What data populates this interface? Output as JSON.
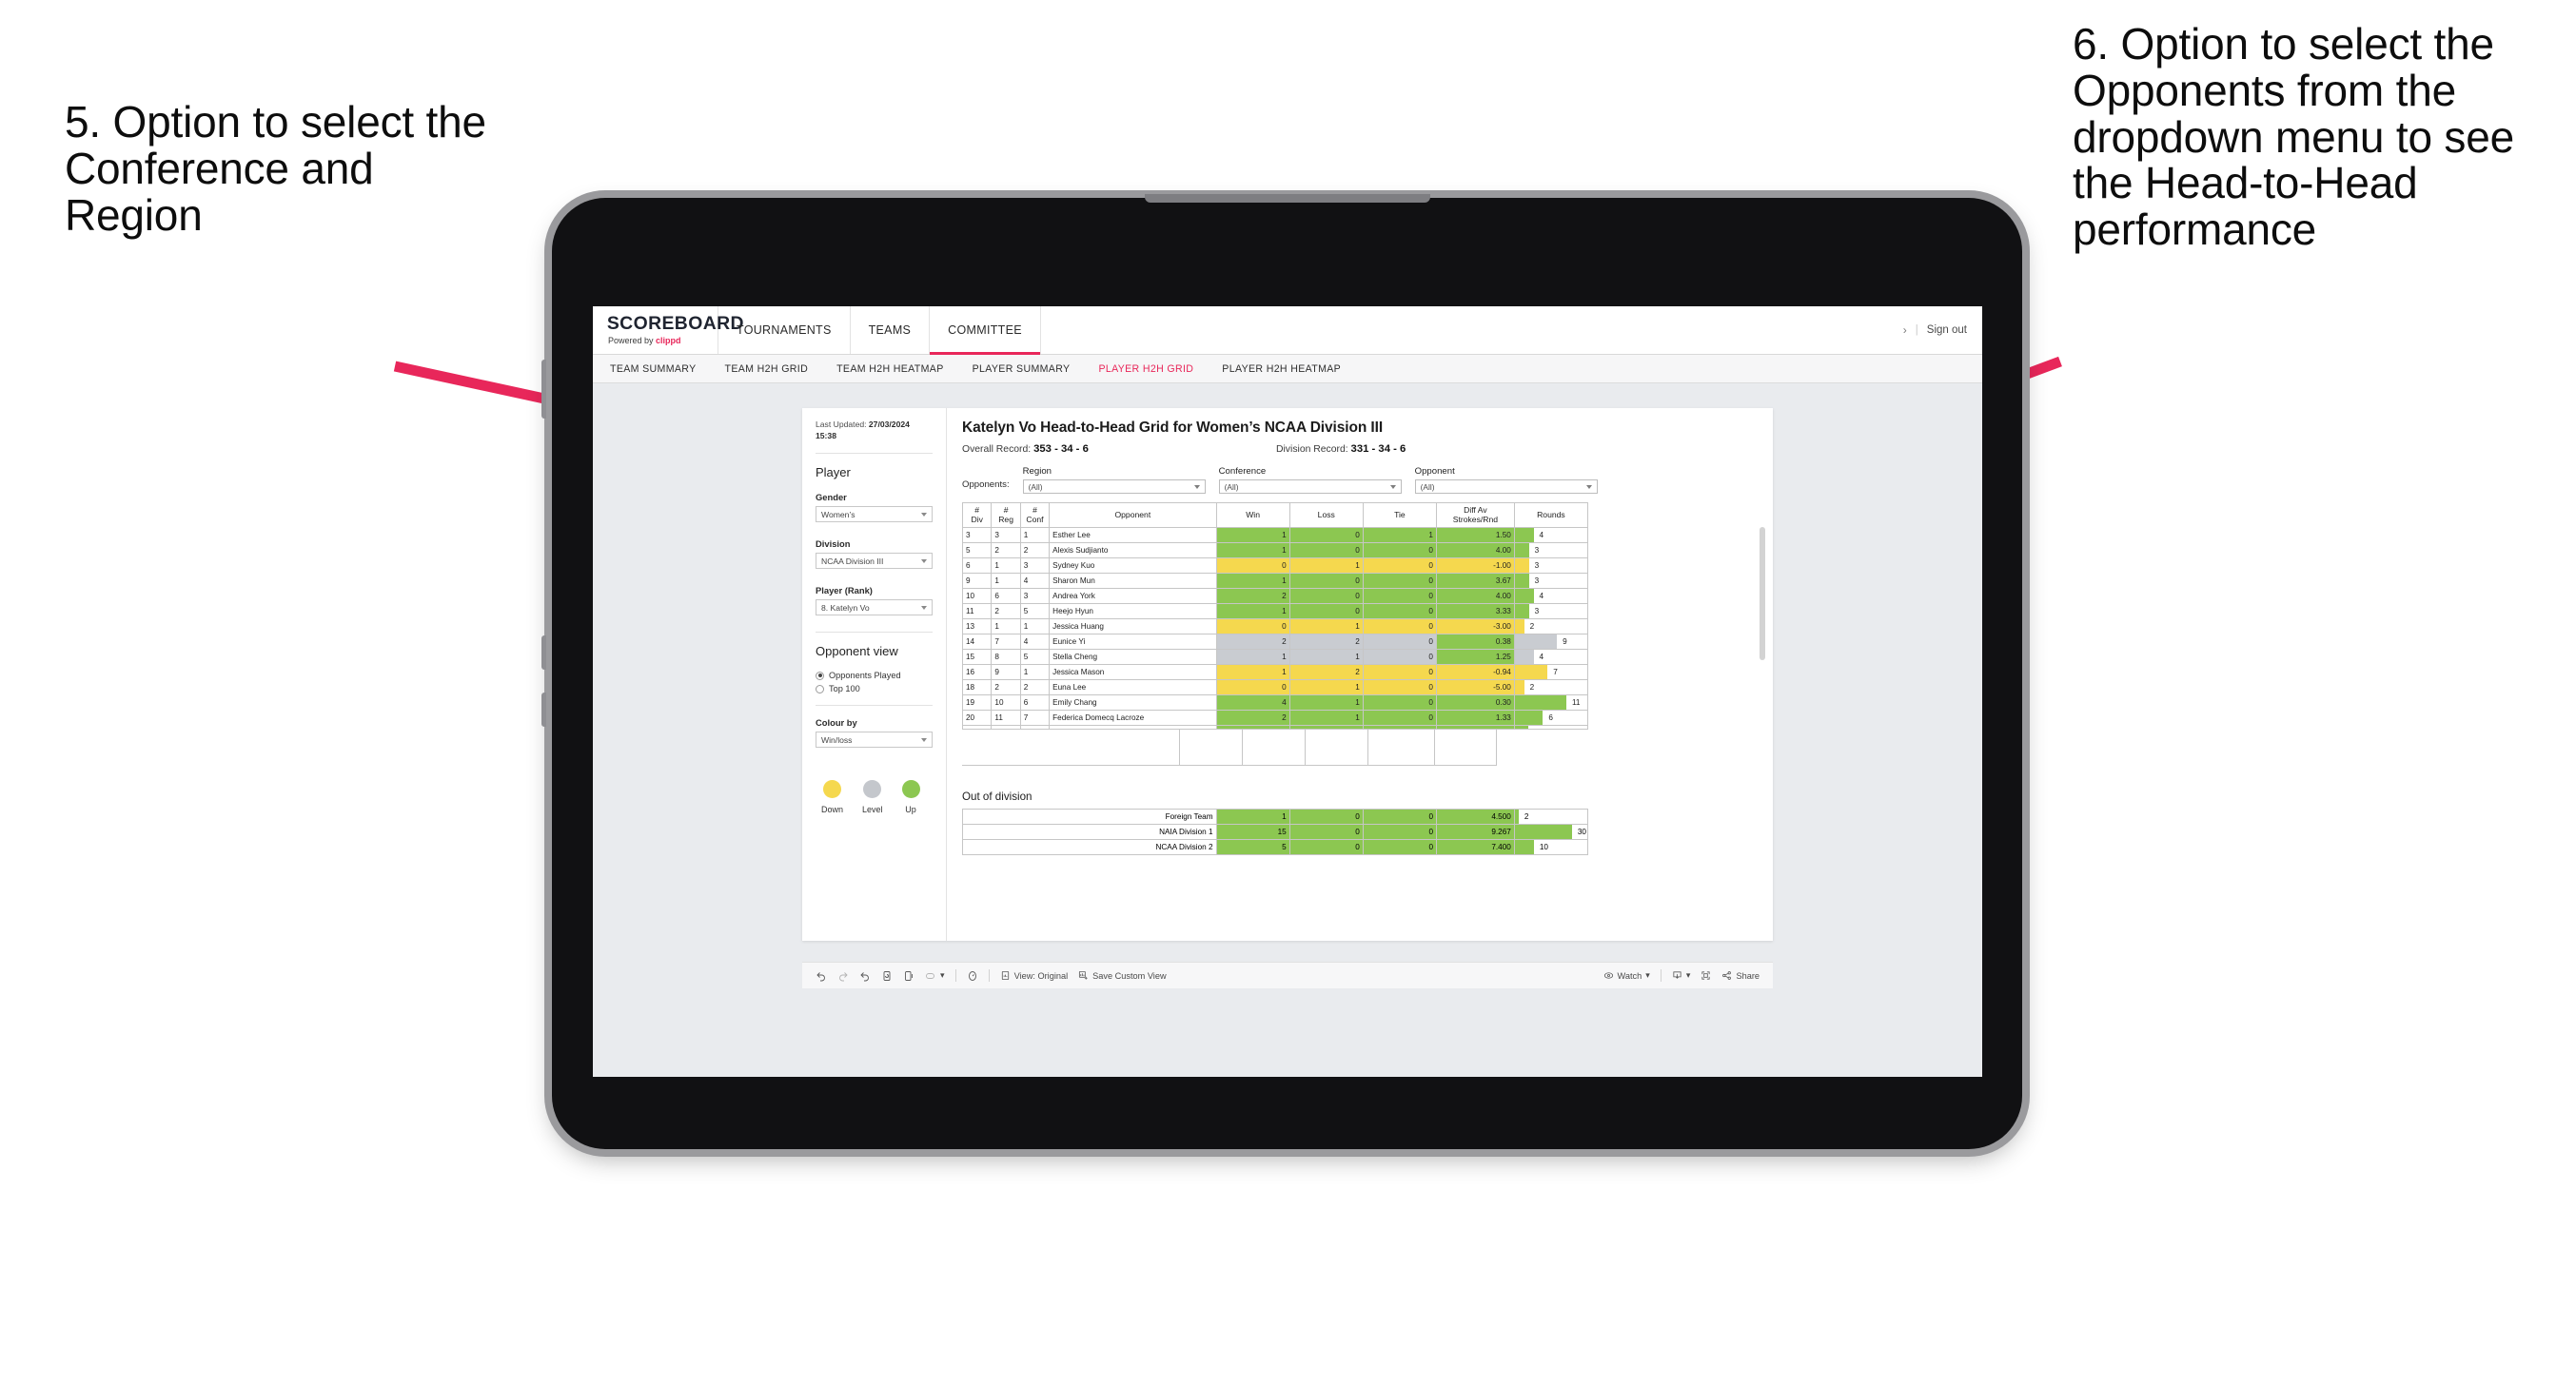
{
  "annotations": {
    "left": "5. Option to select the Conference and Region",
    "right": "6. Option to select the Opponents from the dropdown menu to see the Head-to-Head performance",
    "arrow_color": "#e8275a"
  },
  "app": {
    "logo": {
      "main": "SCOREBOARD",
      "sub_prefix": "Powered by ",
      "brand": "clippd"
    },
    "top_nav": [
      {
        "label": "TOURNAMENTS",
        "active": false
      },
      {
        "label": "TEAMS",
        "active": false
      },
      {
        "label": "COMMITTEE",
        "active": true
      }
    ],
    "header_right": {
      "chevron": "›",
      "separator": "|",
      "sign_out": "Sign out"
    },
    "sub_nav": [
      {
        "label": "TEAM SUMMARY",
        "active": false
      },
      {
        "label": "TEAM H2H GRID",
        "active": false
      },
      {
        "label": "TEAM H2H HEATMAP",
        "active": false
      },
      {
        "label": "PLAYER SUMMARY",
        "active": false
      },
      {
        "label": "PLAYER H2H GRID",
        "active": true
      },
      {
        "label": "PLAYER H2H HEATMAP",
        "active": false
      }
    ],
    "accent_color": "#e8275a"
  },
  "sidebar": {
    "last_updated_label": "Last Updated:",
    "last_updated_value": "27/03/2024",
    "last_updated_time": "15:38",
    "player_group_title": "Player",
    "gender": {
      "label": "Gender",
      "value": "Women’s"
    },
    "division": {
      "label": "Division",
      "value": "NCAA Division III"
    },
    "player_rank": {
      "label": "Player (Rank)",
      "value": "8. Katelyn Vo"
    },
    "opponent_view": {
      "title": "Opponent view",
      "options": [
        {
          "label": "Opponents Played",
          "selected": true
        },
        {
          "label": "Top 100",
          "selected": false
        }
      ]
    },
    "colour_by": {
      "label": "Colour by",
      "value": "Win/loss"
    },
    "legend": [
      {
        "label": "Down",
        "color": "#f5d84e"
      },
      {
        "label": "Level",
        "color": "#c4c7cc"
      },
      {
        "label": "Up",
        "color": "#8cc751"
      }
    ]
  },
  "main": {
    "title": "Katelyn Vo Head-to-Head Grid for Women’s NCAA Division III",
    "overall_record_label": "Overall Record:",
    "overall_record_value": "353 - 34 - 6",
    "division_record_label": "Division Record:",
    "division_record_value": "331 - 34 - 6",
    "opponents_label": "Opponents:",
    "filters": [
      {
        "label": "Region",
        "value": "(All)"
      },
      {
        "label": "Conference",
        "value": "(All)"
      },
      {
        "label": "Opponent",
        "value": "(All)"
      }
    ]
  },
  "chart_data": {
    "type": "table",
    "title": "Katelyn Vo Head-to-Head Grid for Women’s NCAA Division III",
    "columns": [
      "# Div",
      "# Reg",
      "# Conf",
      "Opponent",
      "Win",
      "Loss",
      "Tie",
      "Diff Av Strokes/Rnd",
      "Rounds"
    ],
    "column_headers_multiline": [
      [
        "#",
        "Div"
      ],
      [
        "#",
        "Reg"
      ],
      [
        "#",
        "Conf"
      ],
      [
        "Opponent"
      ],
      [
        "Win"
      ],
      [
        "Loss"
      ],
      [
        "Tie"
      ],
      [
        "Diff Av",
        "Strokes/Rnd"
      ],
      [
        "Rounds"
      ]
    ],
    "rounds_max": 13,
    "rows": [
      {
        "div": "3",
        "reg": "3",
        "conf": "1",
        "opponent": "Esther Lee",
        "win": "1",
        "loss": "0",
        "tie": "1",
        "diff": "1.50",
        "rounds": "4",
        "color": "#8cc751"
      },
      {
        "div": "5",
        "reg": "2",
        "conf": "2",
        "opponent": "Alexis Sudjianto",
        "win": "1",
        "loss": "0",
        "tie": "0",
        "diff": "4.00",
        "rounds": "3",
        "color": "#8cc751"
      },
      {
        "div": "6",
        "reg": "1",
        "conf": "3",
        "opponent": "Sydney Kuo",
        "win": "0",
        "loss": "1",
        "tie": "0",
        "diff": "-1.00",
        "rounds": "3",
        "color": "#f5d84e"
      },
      {
        "div": "9",
        "reg": "1",
        "conf": "4",
        "opponent": "Sharon Mun",
        "win": "1",
        "loss": "0",
        "tie": "0",
        "diff": "3.67",
        "rounds": "3",
        "color": "#8cc751"
      },
      {
        "div": "10",
        "reg": "6",
        "conf": "3",
        "opponent": "Andrea York",
        "win": "2",
        "loss": "0",
        "tie": "0",
        "diff": "4.00",
        "rounds": "4",
        "color": "#8cc751"
      },
      {
        "div": "11",
        "reg": "2",
        "conf": "5",
        "opponent": "Heejo Hyun",
        "win": "1",
        "loss": "0",
        "tie": "0",
        "diff": "3.33",
        "rounds": "3",
        "color": "#8cc751"
      },
      {
        "div": "13",
        "reg": "1",
        "conf": "1",
        "opponent": "Jessica Huang",
        "win": "0",
        "loss": "1",
        "tie": "0",
        "diff": "-3.00",
        "rounds": "2",
        "color": "#f5d84e"
      },
      {
        "div": "14",
        "reg": "7",
        "conf": "4",
        "opponent": "Eunice Yi",
        "win": "2",
        "loss": "2",
        "tie": "0",
        "diff": "0.38",
        "rounds": "9",
        "color": "#c9ccd1",
        "diff_color": "#8cc751"
      },
      {
        "div": "15",
        "reg": "8",
        "conf": "5",
        "opponent": "Stella Cheng",
        "win": "1",
        "loss": "1",
        "tie": "0",
        "diff": "1.25",
        "rounds": "4",
        "color": "#c9ccd1",
        "diff_color": "#8cc751"
      },
      {
        "div": "16",
        "reg": "9",
        "conf": "1",
        "opponent": "Jessica Mason",
        "win": "1",
        "loss": "2",
        "tie": "0",
        "diff": "-0.94",
        "rounds": "7",
        "color": "#f5d84e"
      },
      {
        "div": "18",
        "reg": "2",
        "conf": "2",
        "opponent": "Euna Lee",
        "win": "0",
        "loss": "1",
        "tie": "0",
        "diff": "-5.00",
        "rounds": "2",
        "color": "#f5d84e"
      },
      {
        "div": "19",
        "reg": "10",
        "conf": "6",
        "opponent": "Emily Chang",
        "win": "4",
        "loss": "1",
        "tie": "0",
        "diff": "0.30",
        "rounds": "11",
        "color": "#8cc751"
      },
      {
        "div": "20",
        "reg": "11",
        "conf": "7",
        "opponent": "Federica Domecq Lacroze",
        "win": "2",
        "loss": "1",
        "tie": "0",
        "diff": "1.33",
        "rounds": "6",
        "color": "#8cc751"
      }
    ],
    "out_of_division": {
      "title": "Out of division",
      "rounds_max": 32,
      "rows": [
        {
          "name": "Foreign Team",
          "win": "1",
          "loss": "0",
          "tie": "0",
          "diff": "4.500",
          "rounds": "2",
          "color": "#8cc751"
        },
        {
          "name": "NAIA Division 1",
          "win": "15",
          "loss": "0",
          "tie": "0",
          "diff": "9.267",
          "rounds": "30",
          "color": "#8cc751"
        },
        {
          "name": "NCAA Division 2",
          "win": "5",
          "loss": "0",
          "tie": "0",
          "diff": "7.400",
          "rounds": "10",
          "color": "#8cc751"
        }
      ]
    }
  },
  "toolbar": {
    "undo": "undo-icon",
    "redo": "redo-icon",
    "revert": "revert-icon",
    "refresh": "refresh-data-icon",
    "pause": "pause-auto-update-icon",
    "highlight": "highlight-icon",
    "highlight_caret": "▾",
    "view_original_label": "View: Original",
    "save_custom_view_label": "Save Custom View",
    "watch_label": "Watch",
    "watch_caret": "▾",
    "download_caret": "▾",
    "fullscreen": "fullscreen-icon",
    "share_label": "Share"
  }
}
